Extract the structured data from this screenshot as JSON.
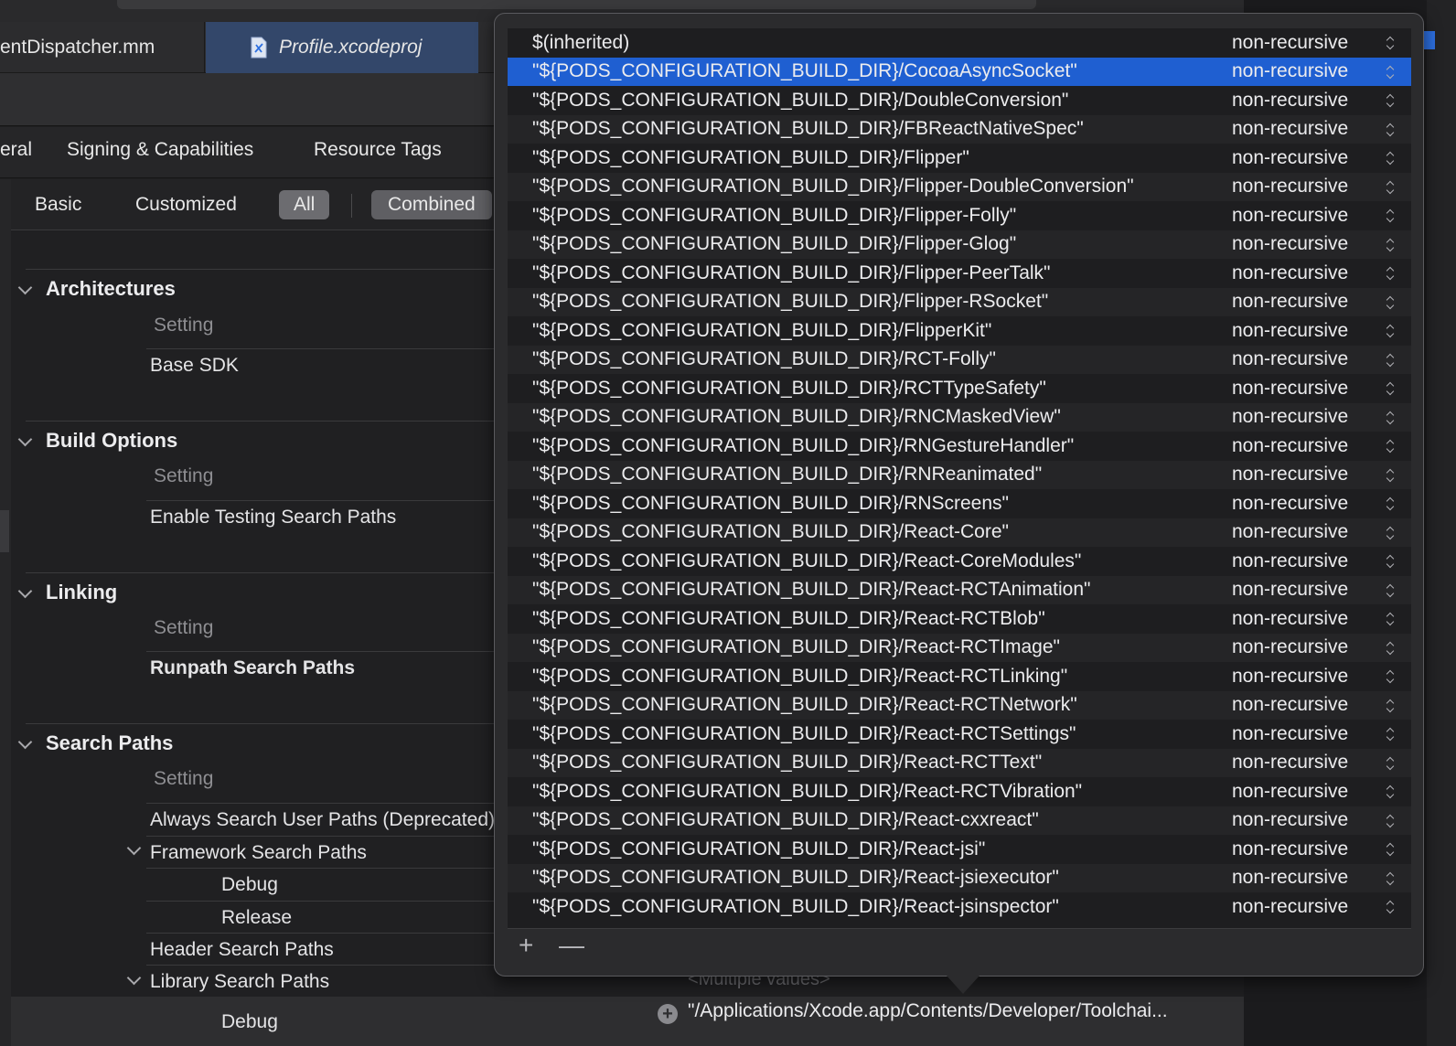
{
  "tabs": {
    "tab1_label": "entDispatcher.mm",
    "tab2_label": "Profile.xcodeproj"
  },
  "section_tabs": {
    "general": "eral",
    "signing": "Signing & Capabilities",
    "resource_tags": "Resource Tags"
  },
  "filters": {
    "basic": "Basic",
    "customized": "Customized",
    "all": "All",
    "combined": "Combined"
  },
  "sections": {
    "architectures": {
      "title": "Architectures",
      "setting_header": "Setting",
      "rows": [
        "Base SDK"
      ]
    },
    "build_options": {
      "title": "Build Options",
      "setting_header": "Setting",
      "rows": [
        "Enable Testing Search Paths"
      ]
    },
    "linking": {
      "title": "Linking",
      "setting_header": "Setting",
      "rows": [
        "Runpath Search Paths"
      ]
    },
    "search_paths": {
      "title": "Search Paths",
      "setting_header": "Setting",
      "always_search": "Always Search User Paths (Deprecated)",
      "framework": "Framework Search Paths",
      "framework_debug": "Debug",
      "framework_release": "Release",
      "header": "Header Search Paths",
      "library": "Library Search Paths",
      "library_debug": "Debug"
    }
  },
  "library_debug_value": "\"/Applications/Xcode.app/Contents/Developer/Toolchai...",
  "multiple_values": "<Multiple values>",
  "popover": {
    "mode": "non-recursive",
    "selected_index": 1,
    "paths": [
      "$(inherited)",
      "\"${PODS_CONFIGURATION_BUILD_DIR}/CocoaAsyncSocket\"",
      "\"${PODS_CONFIGURATION_BUILD_DIR}/DoubleConversion\"",
      "\"${PODS_CONFIGURATION_BUILD_DIR}/FBReactNativeSpec\"",
      "\"${PODS_CONFIGURATION_BUILD_DIR}/Flipper\"",
      "\"${PODS_CONFIGURATION_BUILD_DIR}/Flipper-DoubleConversion\"",
      "\"${PODS_CONFIGURATION_BUILD_DIR}/Flipper-Folly\"",
      "\"${PODS_CONFIGURATION_BUILD_DIR}/Flipper-Glog\"",
      "\"${PODS_CONFIGURATION_BUILD_DIR}/Flipper-PeerTalk\"",
      "\"${PODS_CONFIGURATION_BUILD_DIR}/Flipper-RSocket\"",
      "\"${PODS_CONFIGURATION_BUILD_DIR}/FlipperKit\"",
      "\"${PODS_CONFIGURATION_BUILD_DIR}/RCT-Folly\"",
      "\"${PODS_CONFIGURATION_BUILD_DIR}/RCTTypeSafety\"",
      "\"${PODS_CONFIGURATION_BUILD_DIR}/RNCMaskedView\"",
      "\"${PODS_CONFIGURATION_BUILD_DIR}/RNGestureHandler\"",
      "\"${PODS_CONFIGURATION_BUILD_DIR}/RNReanimated\"",
      "\"${PODS_CONFIGURATION_BUILD_DIR}/RNScreens\"",
      "\"${PODS_CONFIGURATION_BUILD_DIR}/React-Core\"",
      "\"${PODS_CONFIGURATION_BUILD_DIR}/React-CoreModules\"",
      "\"${PODS_CONFIGURATION_BUILD_DIR}/React-RCTAnimation\"",
      "\"${PODS_CONFIGURATION_BUILD_DIR}/React-RCTBlob\"",
      "\"${PODS_CONFIGURATION_BUILD_DIR}/React-RCTImage\"",
      "\"${PODS_CONFIGURATION_BUILD_DIR}/React-RCTLinking\"",
      "\"${PODS_CONFIGURATION_BUILD_DIR}/React-RCTNetwork\"",
      "\"${PODS_CONFIGURATION_BUILD_DIR}/React-RCTSettings\"",
      "\"${PODS_CONFIGURATION_BUILD_DIR}/React-RCTText\"",
      "\"${PODS_CONFIGURATION_BUILD_DIR}/React-RCTVibration\"",
      "\"${PODS_CONFIGURATION_BUILD_DIR}/React-cxxreact\"",
      "\"${PODS_CONFIGURATION_BUILD_DIR}/React-jsi\"",
      "\"${PODS_CONFIGURATION_BUILD_DIR}/React-jsiexecutor\"",
      "\"${PODS_CONFIGURATION_BUILD_DIR}/React-jsinspector\""
    ],
    "add_label": "+",
    "remove_label": "—"
  },
  "colors": {
    "accent": "#1f5fd1",
    "tab_active": "#33476a"
  },
  "icons": {
    "file": "xcodeproj-file-icon",
    "disclosure": "chevron-down-icon",
    "stepper": "up-down-stepper-icon"
  }
}
